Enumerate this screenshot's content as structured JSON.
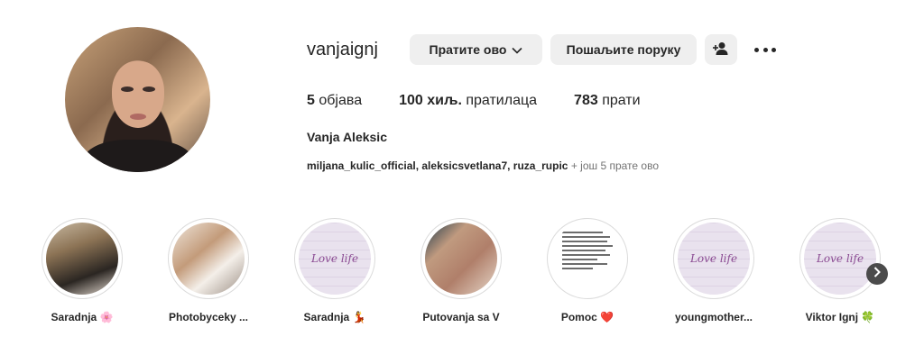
{
  "profile": {
    "username": "vanjaignj",
    "full_name": "Vanja Aleksic",
    "avatar": "avatar"
  },
  "actions": {
    "follow_label": "Пратите ово",
    "message_label": "Пошаљите поруку",
    "add_user_icon": "add-user-icon",
    "more_icon": "more-options-icon"
  },
  "stats": {
    "posts_count": "5",
    "posts_label": " објава",
    "followers_count": "100 хиљ.",
    "followers_label": " пратилаца",
    "following_count": "783",
    "following_label": " прати"
  },
  "followed_by": {
    "names": "miljana_kulic_official, aleksicsvetlana7, ruza_rupic",
    "more": " + још 5 прате ово"
  },
  "highlights": [
    {
      "label": "Saradnja 🌸"
    },
    {
      "label": "Photobyceky ..."
    },
    {
      "label": "Saradnja 💃"
    },
    {
      "label": "Putovanja sa V"
    },
    {
      "label": "Pomoc ❤️"
    },
    {
      "label": "youngmother..."
    },
    {
      "label": "Viktor Ignj 🍀"
    }
  ],
  "highlight_image_text": "Love life",
  "colors": {
    "button_bg": "#efefef",
    "text": "#262626",
    "secondary_text": "#737373",
    "ring_border": "#dbdbdb"
  }
}
